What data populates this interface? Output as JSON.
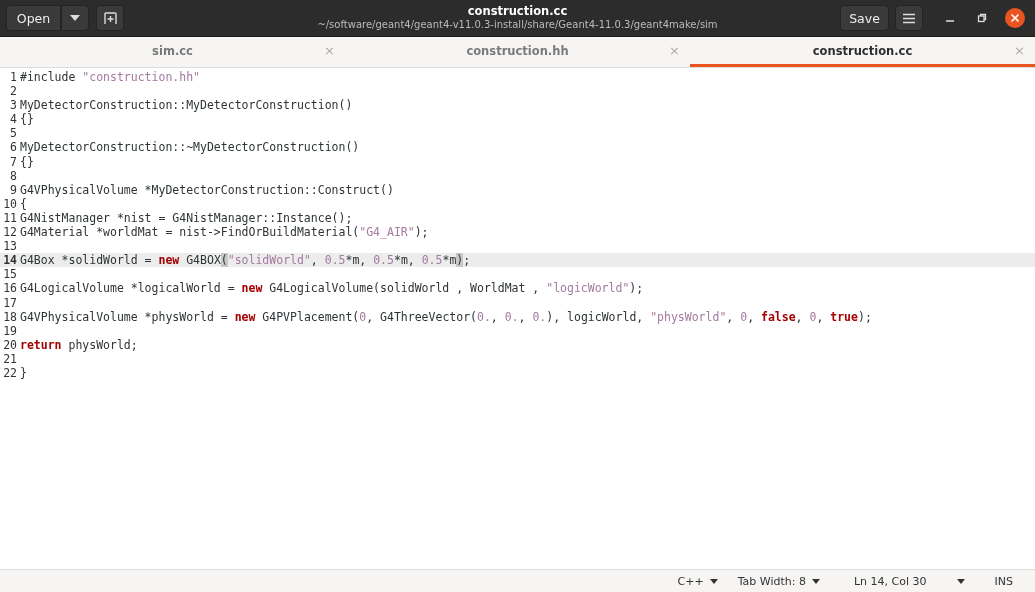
{
  "header": {
    "open_button": "Open",
    "title": "construction.cc",
    "subtitle": "~/software/geant4/geant4-v11.0.3-install/share/Geant4-11.0.3/geant4make/sim",
    "save_button": "Save"
  },
  "tabs": [
    {
      "label": "sim.cc",
      "selected": false,
      "close": "×"
    },
    {
      "label": "construction.hh",
      "selected": false,
      "close": "×"
    },
    {
      "label": "construction.cc",
      "selected": true,
      "close": "×"
    }
  ],
  "lines": [
    {
      "number": "1",
      "current": false,
      "tokens": [
        {
          "kind": "plain",
          "text": "#include "
        },
        {
          "kind": "string",
          "text": "\"construction.hh\""
        }
      ]
    },
    {
      "number": "2",
      "current": false
    },
    {
      "number": "3",
      "current": false,
      "tokens": [
        {
          "kind": "plain",
          "text": "MyDetectorConstruction::MyDetectorConstruction()"
        }
      ]
    },
    {
      "number": "4",
      "current": false,
      "tokens": [
        {
          "kind": "plain",
          "text": "{}"
        }
      ]
    },
    {
      "number": "5",
      "current": false
    },
    {
      "number": "6",
      "current": false,
      "tokens": [
        {
          "kind": "plain",
          "text": "MyDetectorConstruction::~MyDetectorConstruction()"
        }
      ]
    },
    {
      "number": "7",
      "current": false,
      "tokens": [
        {
          "kind": "plain",
          "text": "{}"
        }
      ]
    },
    {
      "number": "8",
      "current": false
    },
    {
      "number": "9",
      "current": false,
      "tokens": [
        {
          "kind": "plain",
          "text": "G4VPhysicalVolume *MyDetectorConstruction::Construct()"
        }
      ]
    },
    {
      "number": "10",
      "current": false,
      "tokens": [
        {
          "kind": "plain",
          "text": "{"
        }
      ]
    },
    {
      "number": "11",
      "current": false,
      "tokens": [
        {
          "kind": "plain",
          "text": "G4NistManager *nist = G4NistManager::Instance();"
        }
      ]
    },
    {
      "number": "12",
      "current": false,
      "tokens": [
        {
          "kind": "plain",
          "text": "G4Material *worldMat = nist->FindOrBuildMaterial("
        },
        {
          "kind": "string",
          "text": "\"G4_AIR\""
        },
        {
          "kind": "plain",
          "text": ");"
        }
      ]
    },
    {
      "number": "13",
      "current": false
    },
    {
      "number": "14",
      "current": true,
      "tokens": [
        {
          "kind": "plain",
          "text": "G4Box *solidWorld = "
        },
        {
          "kind": "keyword",
          "text": "new"
        },
        {
          "kind": "plain",
          "text": " G4BOX"
        },
        {
          "kind": "bracket",
          "text": "("
        },
        {
          "kind": "string",
          "text": "\"solidWorld\""
        },
        {
          "kind": "plain",
          "text": ", "
        },
        {
          "kind": "number",
          "text": "0.5"
        },
        {
          "kind": "plain",
          "text": "*m, "
        },
        {
          "kind": "number",
          "text": "0.5"
        },
        {
          "kind": "plain",
          "text": "*m, "
        },
        {
          "kind": "number",
          "text": "0.5"
        },
        {
          "kind": "plain",
          "text": "*m"
        },
        {
          "kind": "bracket",
          "text": ")"
        },
        {
          "kind": "plain",
          "text": ";"
        }
      ]
    },
    {
      "number": "15",
      "current": false
    },
    {
      "number": "16",
      "current": false,
      "tokens": [
        {
          "kind": "plain",
          "text": "G4LogicalVolume *logicalWorld = "
        },
        {
          "kind": "keyword",
          "text": "new"
        },
        {
          "kind": "plain",
          "text": " G4LogicalVolume(solidWorld , WorldMat , "
        },
        {
          "kind": "string",
          "text": "\"logicWorld\""
        },
        {
          "kind": "plain",
          "text": ");"
        }
      ]
    },
    {
      "number": "17",
      "current": false
    },
    {
      "number": "18",
      "current": false,
      "tokens": [
        {
          "kind": "plain",
          "text": "G4VPhysicalVolume *physWorld = "
        },
        {
          "kind": "keyword",
          "text": "new"
        },
        {
          "kind": "plain",
          "text": " G4PVPlacement("
        },
        {
          "kind": "number",
          "text": "0"
        },
        {
          "kind": "plain",
          "text": ", G4ThreeVector("
        },
        {
          "kind": "number",
          "text": "0."
        },
        {
          "kind": "plain",
          "text": ", "
        },
        {
          "kind": "number",
          "text": "0."
        },
        {
          "kind": "plain",
          "text": ", "
        },
        {
          "kind": "number",
          "text": "0."
        },
        {
          "kind": "plain",
          "text": "), logicWorld, "
        },
        {
          "kind": "string",
          "text": "\"physWorld\""
        },
        {
          "kind": "plain",
          "text": ", "
        },
        {
          "kind": "number",
          "text": "0"
        },
        {
          "kind": "plain",
          "text": ", "
        },
        {
          "kind": "keyword",
          "text": "false"
        },
        {
          "kind": "plain",
          "text": ", "
        },
        {
          "kind": "number",
          "text": "0"
        },
        {
          "kind": "plain",
          "text": ", "
        },
        {
          "kind": "keyword",
          "text": "true"
        },
        {
          "kind": "plain",
          "text": ");"
        }
      ]
    },
    {
      "number": "19",
      "current": false
    },
    {
      "number": "20",
      "current": false,
      "tokens": [
        {
          "kind": "keyword",
          "text": "return"
        },
        {
          "kind": "plain",
          "text": " physWorld;"
        }
      ]
    },
    {
      "number": "21",
      "current": false
    },
    {
      "number": "22",
      "current": false,
      "tokens": [
        {
          "kind": "plain",
          "text": "}"
        }
      ]
    }
  ],
  "status_bar": {
    "language": "C++",
    "tab_width": "Tab Width: 8",
    "position": "Ln 14, Col 30",
    "mode": "INS"
  }
}
